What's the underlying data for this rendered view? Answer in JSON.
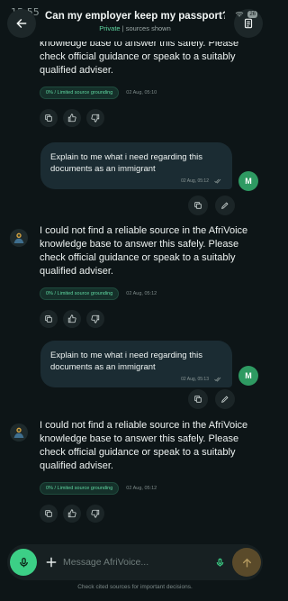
{
  "status_bar": {
    "time": "15:55",
    "battery": "26"
  },
  "header": {
    "title": "Can my employer keep my passport?",
    "subtitle_private": "Private",
    "subtitle_separator": " | ",
    "subtitle_sources": "sources shown"
  },
  "messages": [
    {
      "role": "assistant",
      "text": "knowledge base to answer this safely. Please check official guidance or speak to a suitably qualified adviser.",
      "grounding": "0% / Limited source grounding",
      "timestamp": "02 Aug, 05:10"
    },
    {
      "role": "user",
      "text": "Explain to me what i need regarding this documents as an immigrant",
      "timestamp": "02 Aug, 05:12",
      "avatar": "M"
    },
    {
      "role": "assistant",
      "text": "I could not find a reliable source in the AfriVoice knowledge base to answer this safely. Please check official guidance or speak to a suitably qualified adviser.",
      "grounding": "0% / Limited source grounding",
      "timestamp": "02 Aug, 05:12"
    },
    {
      "role": "user",
      "text": "Explain to me what i need regarding this documents as an immigrant",
      "timestamp": "02 Aug, 05:13",
      "avatar": "M"
    },
    {
      "role": "assistant",
      "text": "I could not find a reliable source in the AfriVoice knowledge base to answer this safely. Please check official guidance or speak to a suitably qualified adviser.",
      "grounding": "0% / Limited source grounding",
      "timestamp": "02 Aug, 05:12"
    }
  ],
  "composer": {
    "placeholder": "Message AfriVoice...",
    "disclaimer": "Check cited sources for important decisions."
  },
  "colors": {
    "background": "#0d1517",
    "accent_green": "#3ccf86",
    "user_bubble": "#1b2c33",
    "send_button": "#5a4a2a"
  },
  "icons": {
    "back": "arrow-left-icon",
    "share": "share-document-icon",
    "copy": "copy-icon",
    "like": "thumbs-up-icon",
    "dislike": "thumbs-down-icon",
    "edit": "pencil-icon",
    "mic": "microphone-icon",
    "plus": "plus-icon",
    "send": "arrow-up-icon",
    "bot": "afrivoice-bot-icon"
  }
}
